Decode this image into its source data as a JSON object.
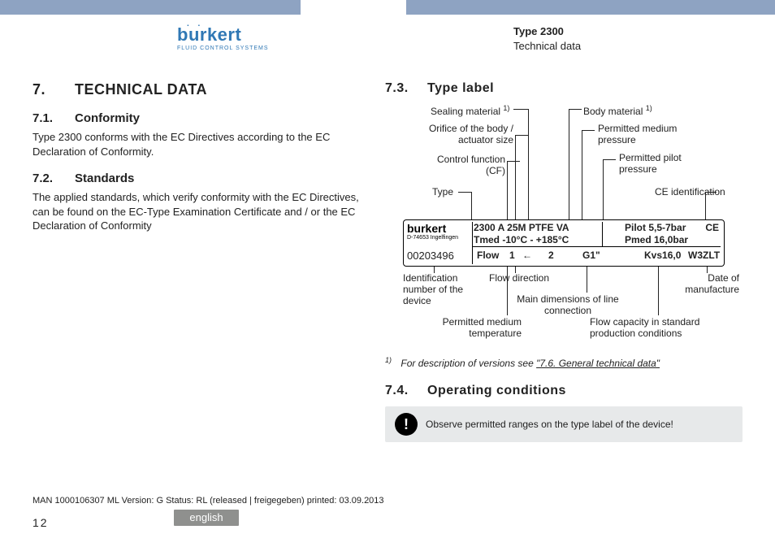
{
  "header": {
    "logo_text": "burkert",
    "logo_sub": "FLUID CONTROL SYSTEMS",
    "type_line": "Type 2300",
    "section_line": "Technical data"
  },
  "left": {
    "h1_num": "7.",
    "h1": "TECHNICAL DATA",
    "s71_num": "7.1.",
    "s71_title": "Conformity",
    "s71_body": "Type 2300 conforms with the EC Directives according to the EC Declaration of Conformity.",
    "s72_num": "7.2.",
    "s72_title": "Standards",
    "s72_body": "The applied standards, which verify conformity with the EC Directives, can be found on the EC-Type Examination Certificate and / or the EC Declaration of Conformity"
  },
  "right": {
    "s73_num": "7.3.",
    "s73_title": "Type label",
    "labels": {
      "sealing": "Sealing material",
      "bodymat": "Body material",
      "orifice": "Orifice of the body / actuator size",
      "pmed": "Permitted medium pressure",
      "cf": "Control function (CF)",
      "ppilot": "Permitted pilot pressure",
      "type": "Type",
      "ceid": "CE identification",
      "idnum": "Identification number of the device",
      "flowdir": "Flow direction",
      "maindim": "Main dimensions of line connection",
      "dom": "Date of manufacture",
      "pmt": "Permitted medium temperature",
      "flowcap": "Flow capacity in standard production conditions"
    },
    "nameplate": {
      "logo": "burkert",
      "logo_sub": "D-74653 Ingelfingen",
      "id": "00203496",
      "line1": "2300 A 25M PTFE VA",
      "line2": "Tmed -10°C - +185°C",
      "pilot": "Pilot 5,5-7bar",
      "pmed": "Pmed 16,0bar",
      "ce": "CE",
      "flow": "Flow",
      "one": "1",
      "two": "2",
      "g1": "G1\"",
      "kvs": "Kvs16,0",
      "w3zlt": "W3ZLT"
    },
    "footnote_pre": "1)",
    "footnote": "For description of versions see ",
    "footnote_link": "\"7.6. General technical data\"",
    "s74_num": "7.4.",
    "s74_title": "Operating conditions",
    "notice": "Observe permitted ranges on the type label of the device!"
  },
  "footer": {
    "line": "MAN 1000106307 ML Version: G Status: RL (released | freigegeben) printed: 03.09.2013",
    "lang": "english",
    "page": "12"
  }
}
